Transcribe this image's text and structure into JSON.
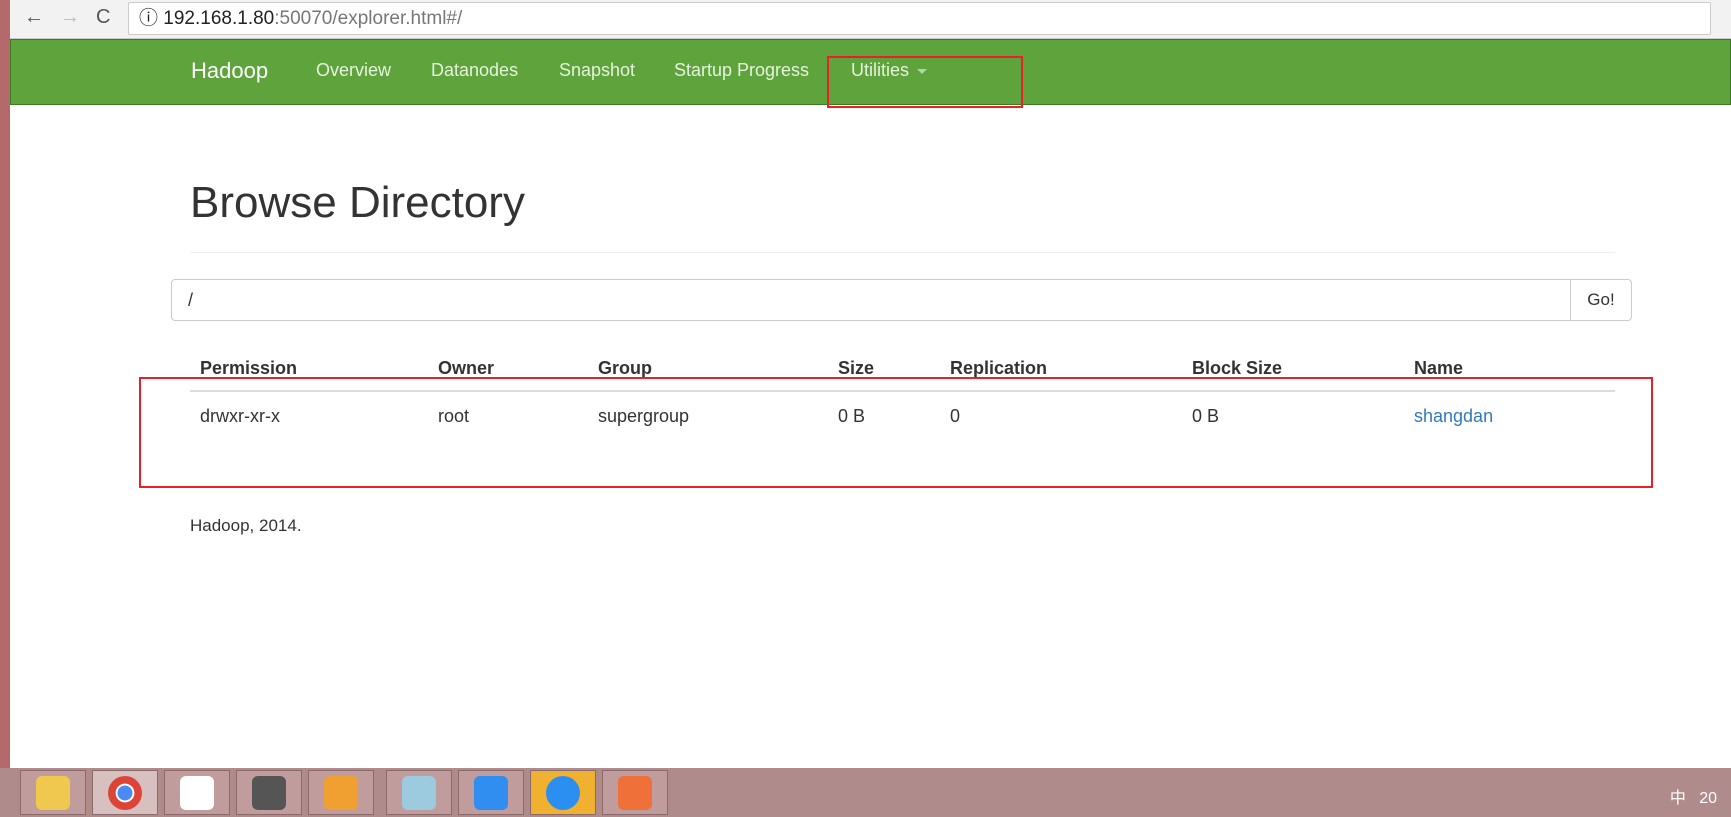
{
  "browser": {
    "url_host": "192.168.1.80",
    "url_rest": ":50070/explorer.html#/",
    "back": "←",
    "forward": "→",
    "reload": "C",
    "info": "ⓘ"
  },
  "nav": {
    "brand": "Hadoop",
    "items": [
      "Overview",
      "Datanodes",
      "Snapshot",
      "Startup Progress",
      "Utilities"
    ]
  },
  "page": {
    "title": "Browse Directory",
    "path": "/",
    "go": "Go!"
  },
  "table": {
    "headers": [
      "Permission",
      "Owner",
      "Group",
      "Size",
      "Replication",
      "Block Size",
      "Name"
    ],
    "rows": [
      [
        "drwxr-xr-x",
        "root",
        "supergroup",
        "0 B",
        "0",
        "0 B",
        "shangdan"
      ]
    ]
  },
  "footer": "Hadoop, 2014.",
  "taskbar": {
    "apps": [
      "file-explorer",
      "chrome",
      "baidu-netdisk",
      "remote-desktop",
      "vmware",
      "notepad",
      "wps",
      "dingtalk",
      "wps-presentation"
    ],
    "tray": "中",
    "clock": "20"
  },
  "colors": {
    "navbar": "#5ea33c",
    "highlight": "#e8202a",
    "link": "#337ab7"
  }
}
